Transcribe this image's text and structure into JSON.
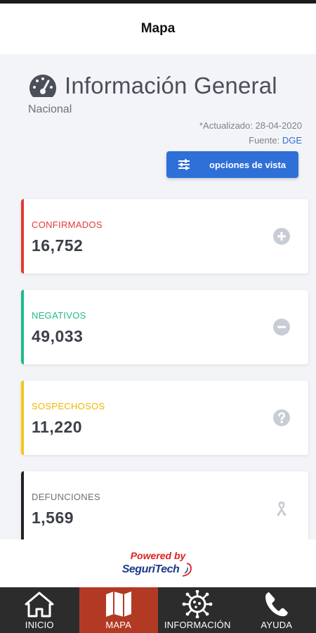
{
  "header": {
    "title": "Mapa"
  },
  "info": {
    "title": "Información General",
    "subtitle": "Nacional",
    "updated": "*Actualizado: 28-04-2020",
    "source_label": "Fuente: ",
    "source_link": "DGE",
    "view_button": "opciones de vista"
  },
  "cards": [
    {
      "label": "CONFIRMADOS",
      "value": "16,752",
      "color": "#e53935",
      "icon": "plus-circle-icon"
    },
    {
      "label": "NEGATIVOS",
      "value": "49,033",
      "color": "#1fba87",
      "icon": "minus-circle-icon"
    },
    {
      "label": "SOSPECHOSOS",
      "value": "11,220",
      "color": "#f5c518",
      "icon": "question-circle-icon"
    },
    {
      "label": "DEFUNCIONES",
      "value": "1,569",
      "color": "#222222",
      "icon": "ribbon-icon"
    }
  ],
  "footer": {
    "powered": "Powered by",
    "brand": "SeguriTech"
  },
  "tabs": [
    {
      "label": "INICIO",
      "icon": "home-icon"
    },
    {
      "label": "MAPA",
      "icon": "map-icon",
      "active": true
    },
    {
      "label": "INFORMACIÓN",
      "icon": "virus-icon"
    },
    {
      "label": "AYUDA",
      "icon": "phone-icon"
    }
  ],
  "colors": {
    "accent": "#2f6fd8",
    "active_tab": "#b23a24",
    "tabbar": "#2c2c2c"
  }
}
